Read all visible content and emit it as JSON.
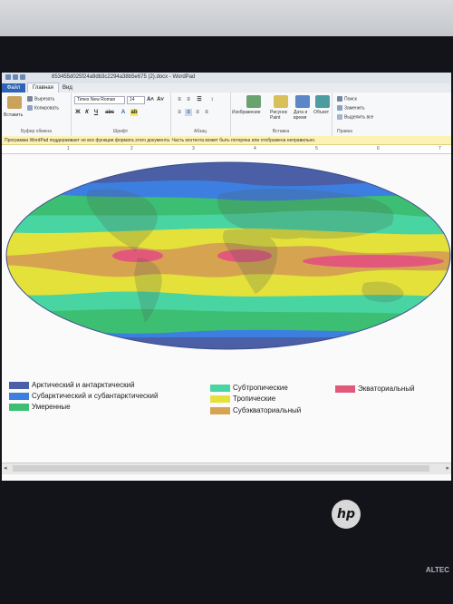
{
  "window": {
    "title": "853455d025f24a9db3c2294a38b5e675 (2).docx - WordPad"
  },
  "ribbon": {
    "tabs": [
      "Файл",
      "Главная",
      "Вид"
    ],
    "clipboard": {
      "paste": "Вставить",
      "cut": "Вырезать",
      "copy": "Копировать",
      "caption": "Буфер обмена"
    },
    "font": {
      "family": "Times New Roman",
      "size": "14",
      "bold": "Ж",
      "italic": "К",
      "underline": "Ч",
      "strike": "abc",
      "caption": "Шрифт"
    },
    "paragraph": {
      "caption": "Абзац"
    },
    "insert": {
      "image": "Изображение",
      "drawing": "Рисунок Paint",
      "datetime": "Дата и время",
      "object": "Объект",
      "caption": "Вставка"
    },
    "editing": {
      "find": "Поиск",
      "replace": "Заменить",
      "select_all": "Выделить все",
      "caption": "Правка"
    }
  },
  "infobar": {
    "message": "Программа WordPad поддерживает не все функции формата этого документа. Часть контента может быть потеряна или отображена неправильно."
  },
  "ruler": {
    "marks": [
      "1",
      "2",
      "3",
      "4",
      "5",
      "6",
      "7"
    ]
  },
  "map": {
    "legend": [
      {
        "label": "Арктический и антарктический",
        "color": "#4a5fa6"
      },
      {
        "label": "Субарктический и субантарктический",
        "color": "#3d7fe0"
      },
      {
        "label": "Умеренные",
        "color": "#3dbf73"
      },
      {
        "label": "Субтропические",
        "color": "#49d5a1"
      },
      {
        "label": "Тропические",
        "color": "#e4e23a"
      },
      {
        "label": "Субэкваториальный",
        "color": "#d6a451"
      },
      {
        "label": "Экваториальный",
        "color": "#e2587a"
      }
    ]
  },
  "device": {
    "logo": "hp",
    "brand": "ALTEC"
  }
}
